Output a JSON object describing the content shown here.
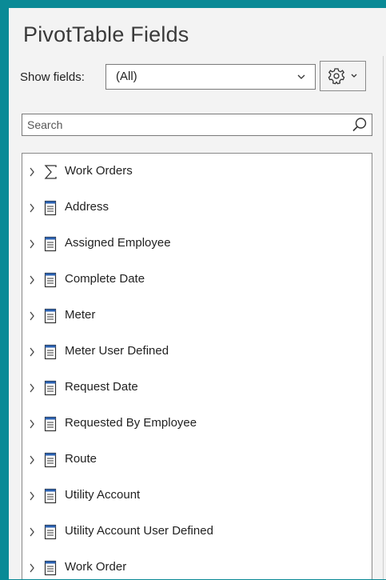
{
  "panel": {
    "title": "PivotTable Fields"
  },
  "show_fields": {
    "label": "Show fields:",
    "value": "(All)"
  },
  "search": {
    "placeholder": "Search"
  },
  "fields": [
    {
      "label": "Work Orders",
      "icon": "sigma-icon"
    },
    {
      "label": "Address",
      "icon": "table-icon"
    },
    {
      "label": "Assigned Employee",
      "icon": "table-icon"
    },
    {
      "label": "Complete Date",
      "icon": "table-icon"
    },
    {
      "label": "Meter",
      "icon": "table-icon"
    },
    {
      "label": "Meter User Defined",
      "icon": "table-icon"
    },
    {
      "label": "Request Date",
      "icon": "table-icon"
    },
    {
      "label": "Requested By Employee",
      "icon": "table-icon"
    },
    {
      "label": "Route",
      "icon": "table-icon"
    },
    {
      "label": "Utility Account",
      "icon": "table-icon"
    },
    {
      "label": "Utility Account User Defined",
      "icon": "table-icon"
    },
    {
      "label": "Work Order",
      "icon": "table-icon"
    }
  ],
  "colors": {
    "background": "#0a8a96",
    "panel": "#f3f3f3",
    "table_icon": "#2b62b3"
  }
}
